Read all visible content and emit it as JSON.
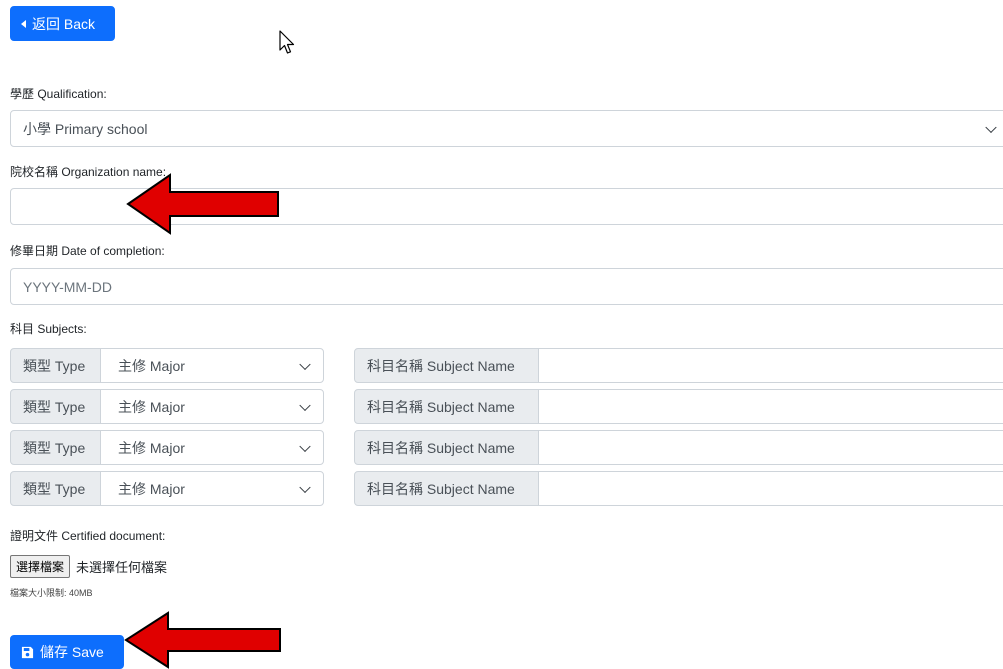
{
  "back_button": {
    "label": "返回 Back"
  },
  "qualification": {
    "label": "學歷 Qualification:",
    "selected": "小學 Primary school"
  },
  "organization": {
    "label": "院校名稱 Organization name:",
    "value": ""
  },
  "completion": {
    "label": "修畢日期 Date of completion:",
    "placeholder": "YYYY-MM-DD"
  },
  "subjects": {
    "label": "科目 Subjects:",
    "rows": [
      {
        "type_label": "類型 Type",
        "type_value": "主修 Major",
        "name_label": "科目名稱 Subject Name",
        "name_value": ""
      },
      {
        "type_label": "類型 Type",
        "type_value": "主修 Major",
        "name_label": "科目名稱 Subject Name",
        "name_value": ""
      },
      {
        "type_label": "類型 Type",
        "type_value": "主修 Major",
        "name_label": "科目名稱 Subject Name",
        "name_value": ""
      },
      {
        "type_label": "類型 Type",
        "type_value": "主修 Major",
        "name_label": "科目名稱 Subject Name",
        "name_value": ""
      }
    ]
  },
  "document": {
    "label": "證明文件 Certified document:",
    "choose_button": "選擇檔案",
    "status": "未選擇任何檔案",
    "size_hint": "檔案大小限制: 40MB"
  },
  "save_button": {
    "label": "儲存 Save"
  },
  "colors": {
    "primary": "#0d6efd",
    "arrow": "#e00000"
  }
}
